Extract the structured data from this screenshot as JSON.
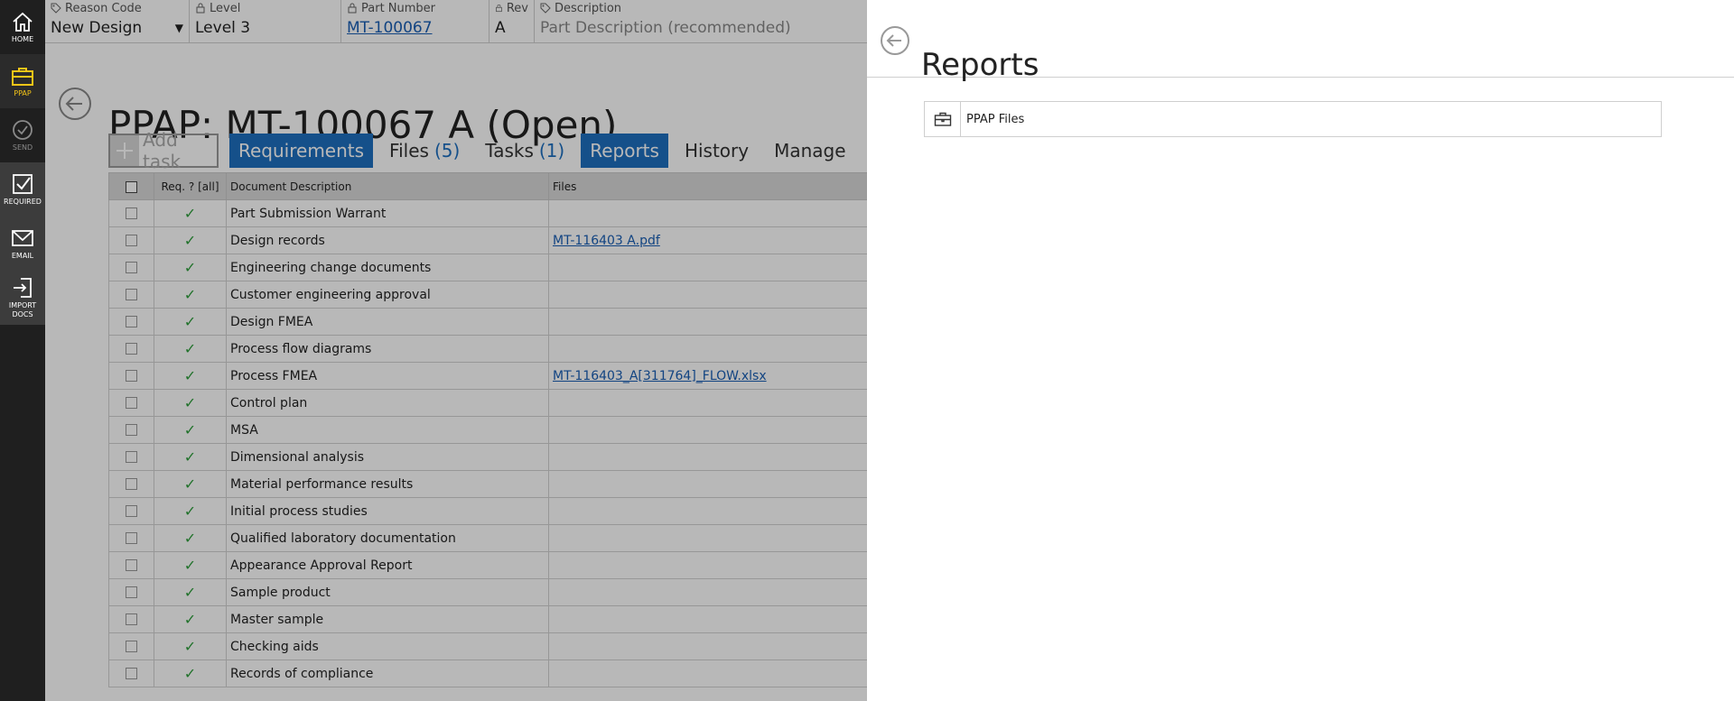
{
  "rail": {
    "items": [
      {
        "label": "HOME",
        "icon": "home-icon"
      },
      {
        "label": "PPAP",
        "icon": "briefcase-icon"
      },
      {
        "label": "SEND",
        "icon": "check-circle-icon"
      },
      {
        "label": "REQUIRED",
        "icon": "checkbox-icon"
      },
      {
        "label": "EMAIL",
        "icon": "envelope-icon"
      },
      {
        "label": "IMPORT DOCS",
        "icon": "import-icon"
      }
    ]
  },
  "header": {
    "reason_code": {
      "label": "Reason Code",
      "value": "New Design"
    },
    "level": {
      "label": "Level",
      "value": "Level 3"
    },
    "part_number": {
      "label": "Part Number",
      "value": "MT-100067"
    },
    "rev": {
      "label": "Rev",
      "value": "A"
    },
    "description": {
      "label": "Description",
      "placeholder": "Part Description (recommended)"
    }
  },
  "page": {
    "title": "PPAP: MT-100067 A (Open)"
  },
  "tabs": {
    "add_task": "Add task",
    "requirements": "Requirements",
    "files": "Files",
    "files_count": "(5)",
    "tasks": "Tasks",
    "tasks_count": "(1)",
    "reports": "Reports",
    "history": "History",
    "manage": "Manage"
  },
  "grid": {
    "columns": {
      "req": "Req. ? [all]",
      "desc": "Document Description",
      "files": "Files"
    },
    "rows": [
      {
        "desc": "Part Submission Warrant",
        "file": ""
      },
      {
        "desc": "Design records",
        "file": "MT-116403 A.pdf"
      },
      {
        "desc": "Engineering change documents",
        "file": ""
      },
      {
        "desc": "Customer engineering approval",
        "file": ""
      },
      {
        "desc": "Design FMEA",
        "file": ""
      },
      {
        "desc": "Process flow diagrams",
        "file": ""
      },
      {
        "desc": "Process FMEA",
        "file": "MT-116403_A[311764]_FLOW.xlsx"
      },
      {
        "desc": "Control plan",
        "file": ""
      },
      {
        "desc": "MSA",
        "file": ""
      },
      {
        "desc": "Dimensional analysis",
        "file": ""
      },
      {
        "desc": "Material performance results",
        "file": ""
      },
      {
        "desc": "Initial process studies",
        "file": ""
      },
      {
        "desc": "Qualified laboratory documentation",
        "file": ""
      },
      {
        "desc": "Appearance Approval Report",
        "file": ""
      },
      {
        "desc": "Sample product",
        "file": ""
      },
      {
        "desc": "Master sample",
        "file": ""
      },
      {
        "desc": "Checking aids",
        "file": ""
      },
      {
        "desc": "Records of compliance",
        "file": ""
      }
    ]
  },
  "drawer": {
    "title": "Reports",
    "items": [
      {
        "label": "PPAP Files",
        "icon": "briefcase-icon"
      }
    ]
  },
  "colors": {
    "accent": "#1e6fc0",
    "check": "#2e9e3c",
    "active_rail": "#f5c518"
  }
}
